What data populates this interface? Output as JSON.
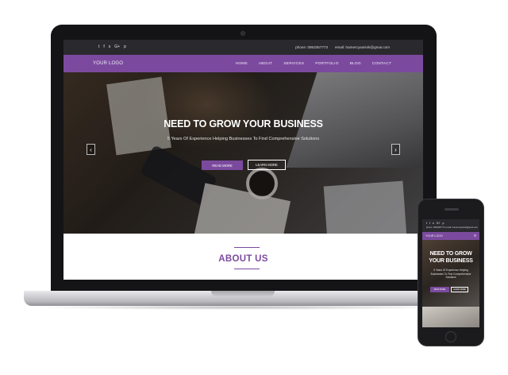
{
  "laptop": {
    "topbar": {
      "social_icons": [
        "twitter-icon",
        "facebook-icon",
        "skype-icon",
        "google-plus-icon",
        "pinterest-icon"
      ],
      "social_glyphs": [
        "t",
        "f",
        "s",
        "G+",
        "p"
      ],
      "phone": "phone: 0953357773",
      "email": "email: hamercyaoisnk@gmai.com"
    },
    "nav": {
      "logo": "YOUR LOGO",
      "menu": [
        "HOME",
        "ABOUT",
        "SERVICES",
        "PORTFOLIO",
        "BLOG",
        "CONTACT"
      ]
    },
    "hero": {
      "title": "NEED TO GROW YOUR BUSINESS",
      "subtitle": "5 Years Of Experience Helping Businesses To Find Comprehensive Solutions",
      "read_more": "READ MORE",
      "learn_more": "LEARN MORE",
      "prev": "‹",
      "next": "›"
    },
    "about": {
      "title": "ABOUT US"
    }
  },
  "phone": {
    "social_glyphs": [
      "t",
      "f",
      "s",
      "G+",
      "p"
    ],
    "contact": "phone: 0953357773  email: hamercyaoisnk@gmai.com",
    "logo": "YOUR LOGO",
    "menu_glyph": "≡",
    "title_line1": "NEED TO GROW",
    "title_line2": "YOUR BUSINESS",
    "subtitle": "5 Years Of Experience Helping Businesses To Find Comprehensive Solutions",
    "read_more": "READ MORE",
    "learn_more": "LEARN MORE"
  },
  "colors": {
    "accent": "#7b4a9e",
    "topbar": "#2a2a2e",
    "device": "#141416"
  }
}
